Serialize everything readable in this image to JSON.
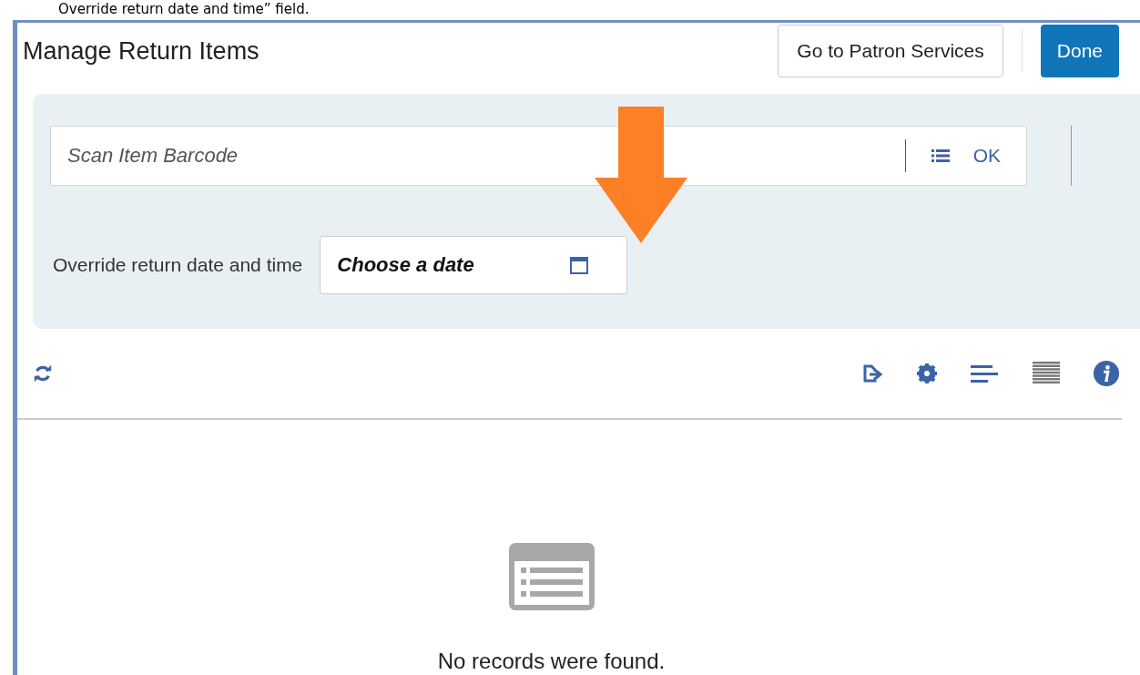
{
  "caption": "Override return date and time” field.",
  "header": {
    "title": "Manage Return Items",
    "buttons": [
      {
        "label": "Go to Patron Services",
        "kind": "secondary"
      },
      {
        "label": "Done",
        "kind": "primary"
      }
    ]
  },
  "scan": {
    "placeholder": "Scan Item Barcode",
    "ok": "OK"
  },
  "override": {
    "label": "Override return date and time",
    "placeholder": "Choose a date"
  },
  "empty": {
    "message": "No records were found."
  }
}
